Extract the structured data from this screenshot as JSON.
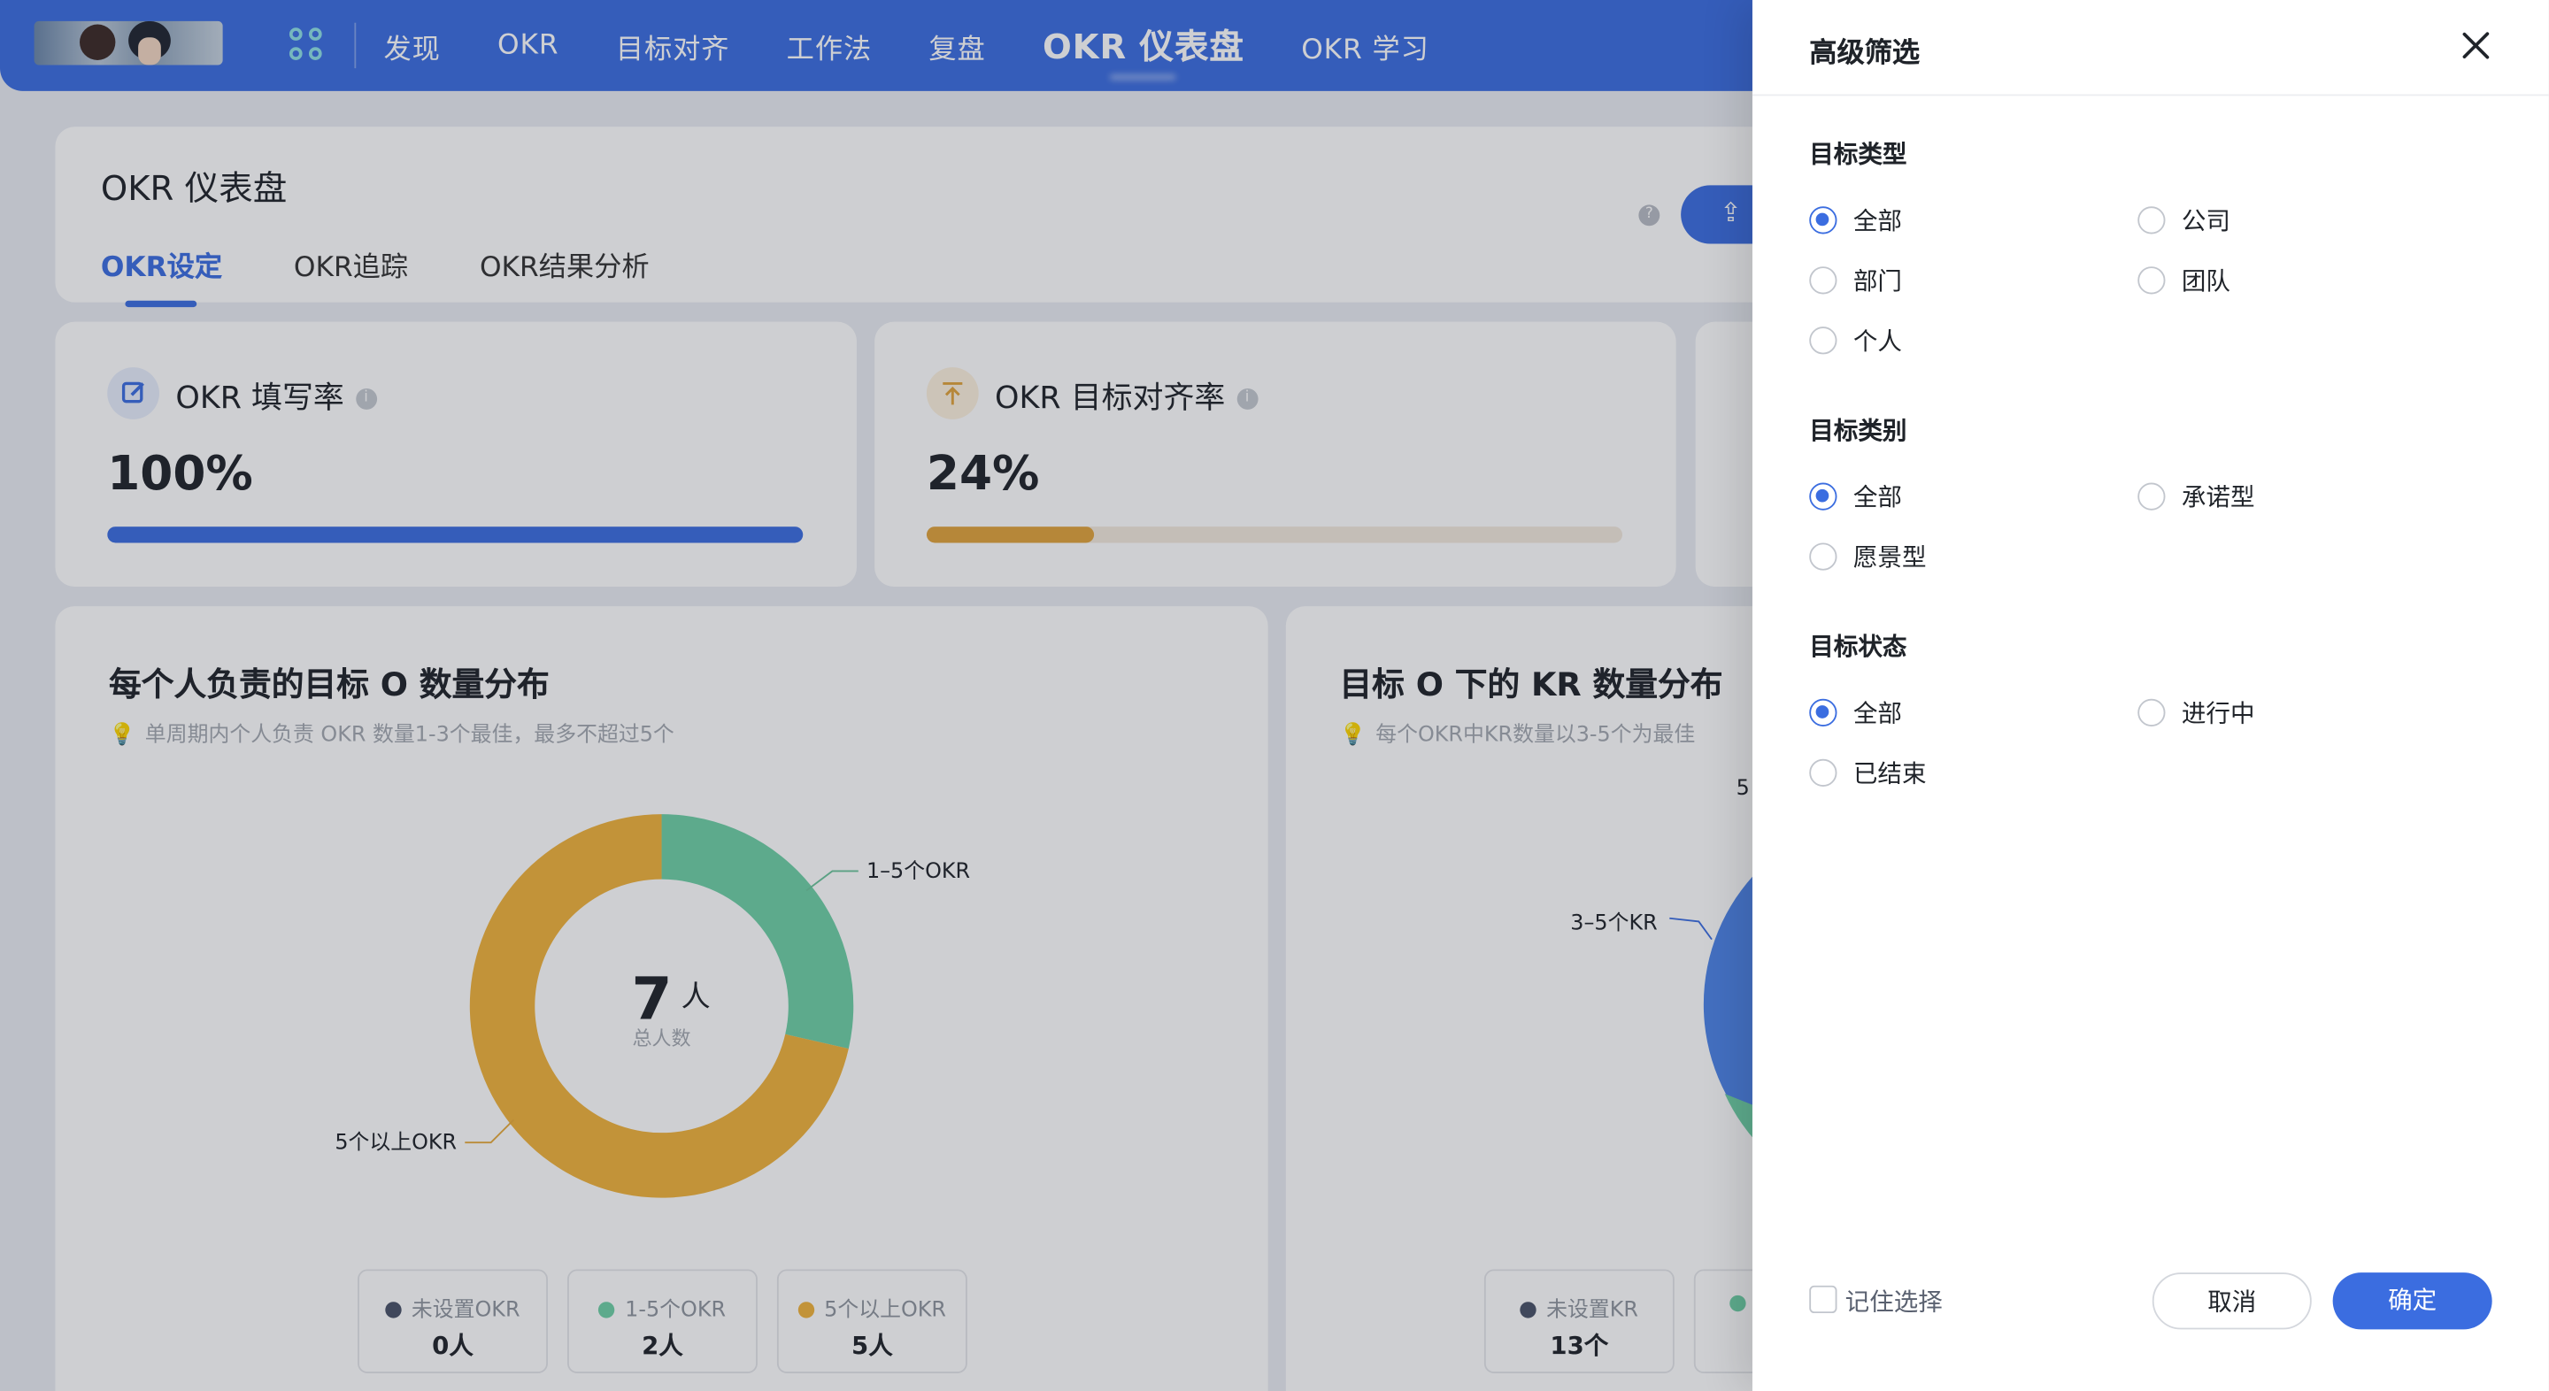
{
  "nav": {
    "items": [
      "发现",
      "OKR",
      "目标对齐",
      "工作法",
      "复盘",
      "OKR 仪表盘",
      "OKR 学习"
    ],
    "active": "OKR 仪表盘"
  },
  "header": {
    "title": "OKR 仪表盘",
    "tabs": [
      "OKR设定",
      "OKR追踪",
      "OKR结果分析"
    ],
    "help": "?"
  },
  "stats": [
    {
      "label": "OKR 填写率",
      "value": "100%",
      "progress": 1.0,
      "color": "#3b6de0",
      "icon": "edit-icon"
    },
    {
      "label": "OKR 目标对齐率",
      "value": "24%",
      "progress": 0.24,
      "color": "#e0a33c",
      "icon": "align-top-icon"
    }
  ],
  "charts": {
    "left": {
      "title": "每个人负责的目标 O 数量分布",
      "tip": "单周期内个人负责 OKR 数量1-3个最佳，最多不超过5个",
      "center_value": "7",
      "center_unit": "人",
      "center_label": "总人数",
      "legend": [
        {
          "name": "未设置OKR",
          "value": "0人",
          "color": "#4a5368"
        },
        {
          "name": "1-5个OKR",
          "value": "2人",
          "color": "#6fd0a6"
        },
        {
          "name": "5个以上OKR",
          "value": "5人",
          "color": "#f0b23c"
        }
      ]
    },
    "right": {
      "title": "目标 O 下的 KR 数量分布",
      "tip": "每个OKR中KR数量以3-5个为最佳",
      "legend": [
        {
          "name": "未设置KR",
          "value": "13个",
          "color": "#4a5368"
        }
      ]
    }
  },
  "chart_data": [
    {
      "type": "pie",
      "title": "每个人负责的目标 O 数量分布",
      "categories": [
        "未设置OKR",
        "1-5个OKR",
        "5个以上OKR"
      ],
      "values": [
        0,
        2,
        5
      ],
      "data_labels": [
        "1–5个OKR",
        "5个以上OKR"
      ],
      "colors": [
        "#4a5368",
        "#6fd0a6",
        "#f0b23c"
      ],
      "donut": true,
      "legend": "bottom"
    }
  ],
  "drawer": {
    "title": "高级筛选",
    "groups": [
      {
        "label": "目标类型",
        "options": [
          "全部",
          "公司",
          "部门",
          "团队",
          "个人"
        ],
        "selected": "全部"
      },
      {
        "label": "目标类别",
        "options": [
          "全部",
          "承诺型",
          "愿景型"
        ],
        "selected": "全部"
      },
      {
        "label": "目标状态",
        "options": [
          "全部",
          "进行中",
          "已结束"
        ],
        "selected": "全部"
      }
    ],
    "remember": "记住选择",
    "cancel": "取消",
    "ok": "确定"
  },
  "right_chart_partial": {
    "label_top": "5",
    "label_kr": "3–5个KR"
  }
}
